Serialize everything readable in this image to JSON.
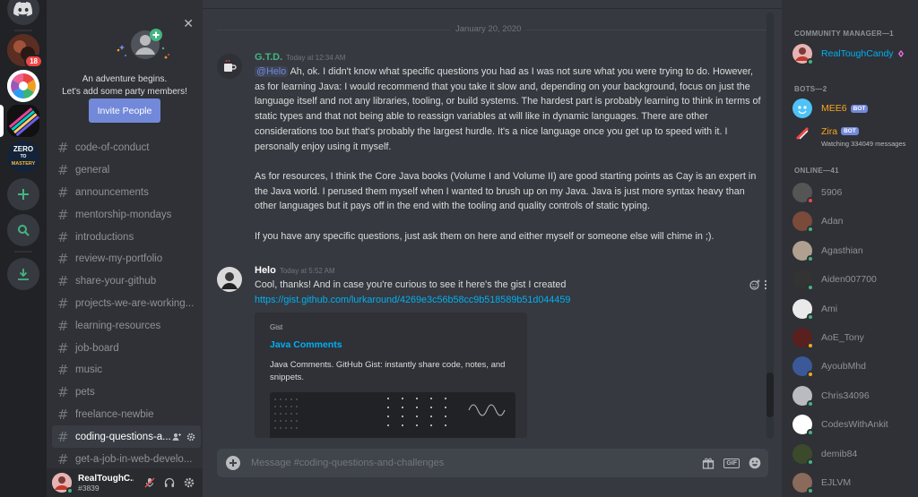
{
  "servers": [
    {
      "name": "discord-home",
      "badge": ""
    },
    {
      "name": "server-1",
      "badge": "18"
    },
    {
      "name": "server-2",
      "badge": ""
    },
    {
      "name": "server-3",
      "badge": ""
    },
    {
      "name": "zero-to-mastery",
      "badge": "",
      "text_top": "ZERO",
      "text_mid": "TO",
      "text_bot": "MASTERY"
    }
  ],
  "promo": {
    "line1": "An adventure begins.",
    "line2": "Let's add some party members!",
    "invite_label": "Invite People",
    "close_glyph": "✕"
  },
  "channels": [
    {
      "name": "code-of-conduct"
    },
    {
      "name": "general"
    },
    {
      "name": "announcements"
    },
    {
      "name": "mentorship-mondays"
    },
    {
      "name": "introductions"
    },
    {
      "name": "review-my-portfolio"
    },
    {
      "name": "share-your-github"
    },
    {
      "name": "projects-we-are-working..."
    },
    {
      "name": "learning-resources"
    },
    {
      "name": "job-board"
    },
    {
      "name": "music"
    },
    {
      "name": "pets"
    },
    {
      "name": "freelance-newbie"
    },
    {
      "name": "coding-questions-a..."
    },
    {
      "name": "get-a-job-in-web-develo..."
    }
  ],
  "user": {
    "name": "RealToughC...",
    "tag": "#3839"
  },
  "chat": {
    "date_divider": "January 20, 2020",
    "messages": [
      {
        "author": "G.T.D.",
        "time": "Today at 12:34 AM",
        "mention": "@Helo",
        "p1": " Ah, ok. I didn't know what specific questions you had as I was not sure what you were trying to do. However, as for learning Java: I would recommend that you take it slow and, depending on your background, focus on just the language itself and not any libraries, tooling, or build systems. The hardest part is probably learning to think in terms of static types and that not being able to reassign variables at will like in dynamic languages. There are other considerations too but that's probably the largest hurdle. It's a nice language once you get up to speed with it. I personally enjoy using it myself.",
        "p2": "As for resources, I think the Core Java books (Volume I and Volume II) are good starting points as Cay is an expert in the Java world. I perused them myself when I wanted to brush up on my Java. Java is just more syntax heavy than other languages but it pays off in the end with the tooling and quality controls of static typing.",
        "p3": "If you have any specific questions, just ask them on here and either myself or someone else will chime in ;)."
      },
      {
        "author": "Helo",
        "time": "Today at 5:52 AM",
        "text": "Cool, thanks! And in case you're curious to see it here's the gist I created",
        "link": "https://gist.github.com/lurkaround/4269e3c56b58cc9b518589b51d044459"
      }
    ],
    "embed": {
      "provider": "Gist",
      "title": "Java Comments",
      "description": "Java Comments. GitHub Gist: instantly share code, notes, and snippets."
    },
    "composer_placeholder": "Message #coding-questions-and-challenges",
    "gif_label": "GIF"
  },
  "members": {
    "groups": [
      {
        "title": "COMMUNITY MANAGER—1"
      },
      {
        "title": "BOTS—2"
      },
      {
        "title": "ONLINE—41"
      }
    ],
    "manager": {
      "name": "RealToughCandy",
      "color": "#00b0f4"
    },
    "bots": [
      {
        "name": "MEE6",
        "tag": "BOT",
        "color": "#faa61a",
        "sub": ""
      },
      {
        "name": "Zira",
        "tag": "BOT",
        "color": "#faa61a",
        "sub": "Watching 334049 messages"
      }
    ],
    "online": [
      {
        "name": "5906",
        "status": "dnd"
      },
      {
        "name": "Adan",
        "status": "online"
      },
      {
        "name": "Agasthian",
        "status": "online"
      },
      {
        "name": "Aiden007700",
        "status": "online"
      },
      {
        "name": "Ami",
        "status": "online"
      },
      {
        "name": "AoE_Tony",
        "status": "idle"
      },
      {
        "name": "AyoubMhd",
        "status": "idle"
      },
      {
        "name": "Chris34096",
        "status": "online"
      },
      {
        "name": "CodesWithAnkit",
        "status": "online"
      },
      {
        "name": "demib84",
        "status": "online"
      },
      {
        "name": "EJLVM",
        "status": "online"
      }
    ]
  },
  "colors": {
    "online": "#43b581",
    "idle": "#faa61a",
    "dnd": "#f04747",
    "accent": "#7289da",
    "link": "#00b0f4"
  }
}
